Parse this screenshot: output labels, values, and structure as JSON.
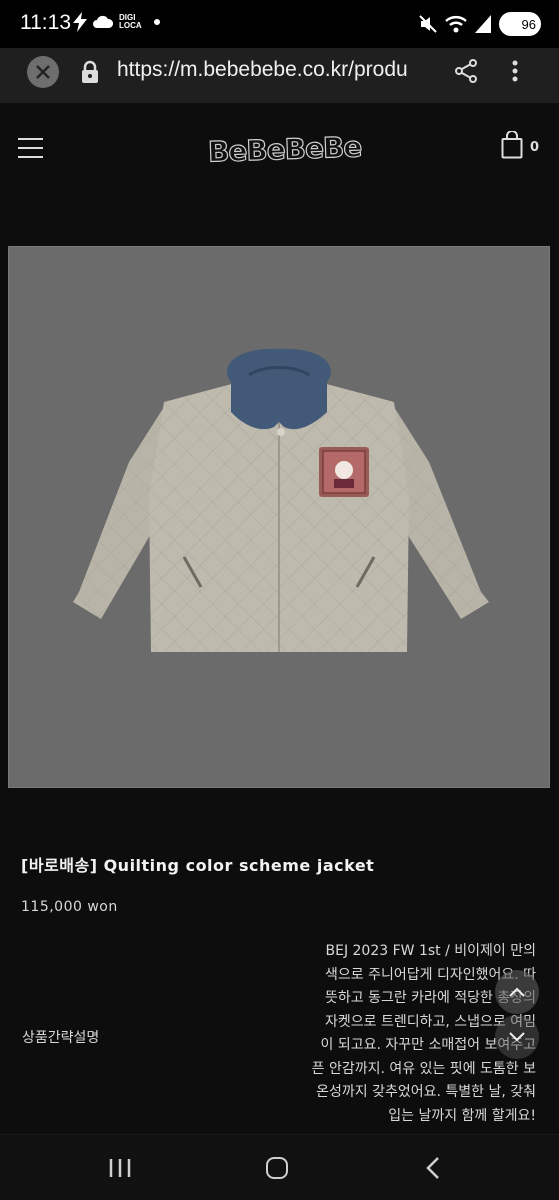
{
  "status_bar": {
    "time": "11:13",
    "digi_line1": "DIGI",
    "digi_line2": "LOCA",
    "battery": "96",
    "icons": [
      "bolt-icon",
      "cloud-icon",
      "dot-icon",
      "mute-icon",
      "wifi-icon",
      "signal-icon",
      "battery-icon"
    ]
  },
  "browser": {
    "url": "https://m.bebebebe.co.kr/produ",
    "icons": [
      "close-icon",
      "lock-icon",
      "share-icon",
      "more-vert-icon"
    ]
  },
  "header": {
    "logo": "BeBeBeBe",
    "cart_count": "0",
    "icons": [
      "menu-icon",
      "cart-icon"
    ]
  },
  "product": {
    "title": "[바로배송] Quilting color scheme jacket",
    "price": "115,000 won",
    "desc_label": "상품간략설명",
    "desc_lines": [
      "BEJ 2023 FW 1st / 비이제이 만의",
      "색으로 주니어답게 디자인했어요. 따",
      "뜻하고 동그란 카라에 적당한 총장의",
      "자켓으로 트렌디하고, 스냅으로 여밈",
      "이 되고요. 자꾸만 소매접어 보여주고",
      "픈 안감까지. 여유 있는 핏에 도톰한 보",
      "온성까지 갖추었어요. 특별한 날, 갖춰",
      "입는 날까지 함께 할게요!"
    ],
    "image_name": "quilted-jacket-image",
    "colors": {
      "background": "#6b6b6b",
      "jacket": "#b9b4a8",
      "collar": "#425a77",
      "patch": "#9a5a55"
    }
  },
  "nav": {
    "icons": [
      "recent-apps-icon",
      "home-icon",
      "back-icon"
    ]
  }
}
